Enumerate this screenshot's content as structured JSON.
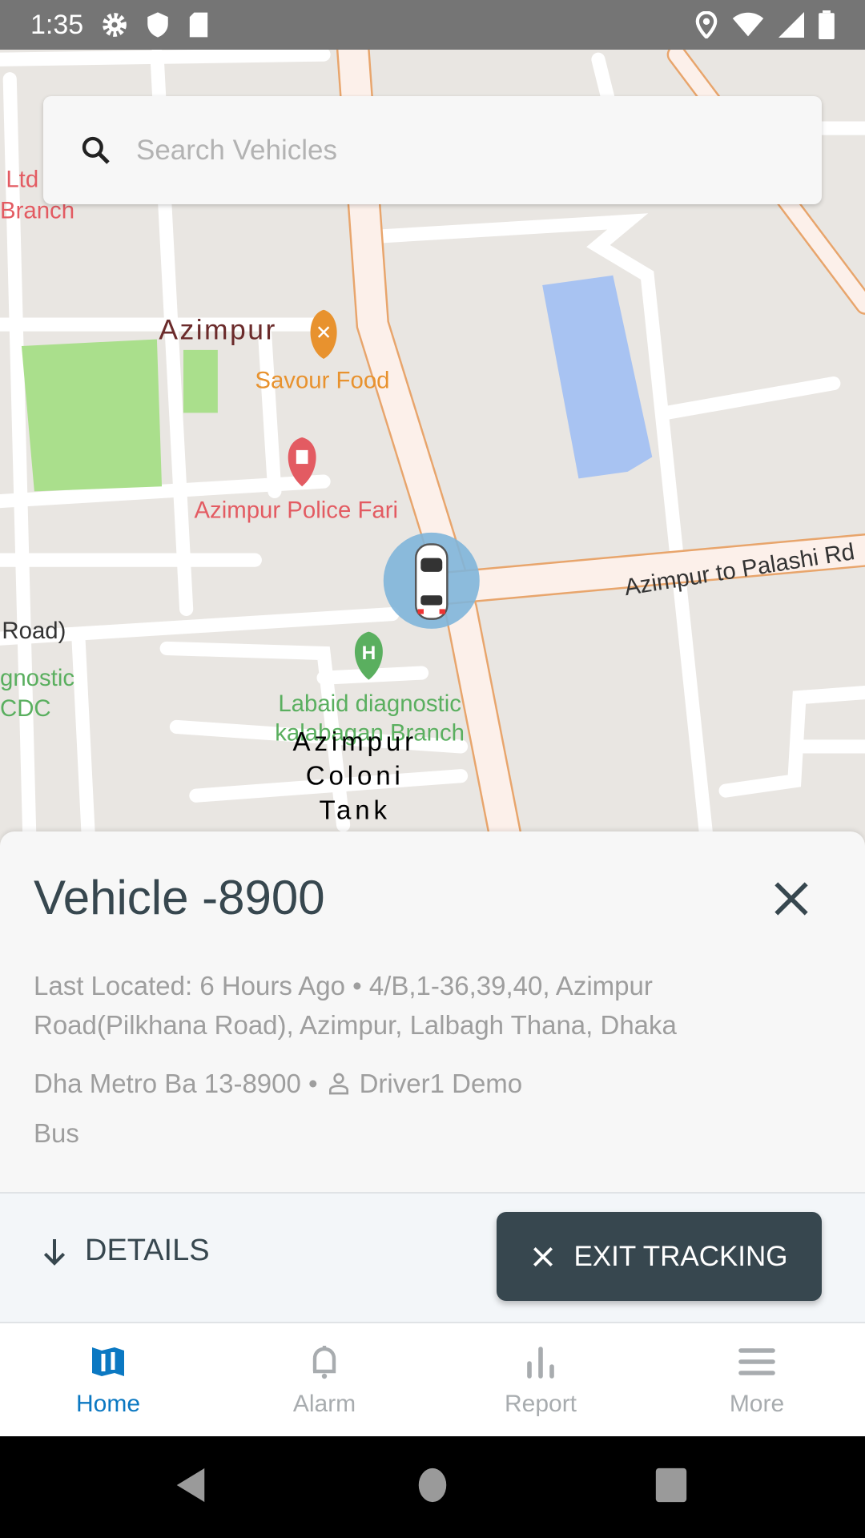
{
  "status_bar": {
    "time": "1:35",
    "icons": [
      "gear-icon",
      "shield-icon",
      "sd-card-icon",
      "location-icon",
      "wifi-icon",
      "signal-icon",
      "battery-icon"
    ]
  },
  "search": {
    "placeholder": "Search Vehicles",
    "value": ""
  },
  "map": {
    "labels": {
      "ltd": "Ltd",
      "branch": "Branch",
      "azimpur": "Azimpur",
      "savour": "Savour Food",
      "police": "Azimpur Police Fari",
      "palashi": "Azimpur to Palashi Rd",
      "road": "Road)",
      "gnostic": "gnostic",
      "cdc": "CDC",
      "labaid1": "Labaid diagnostic",
      "labaid2": "kalabagan Branch",
      "colony1": "Azimpur",
      "colony2": "Coloni",
      "colony3": "Tank"
    },
    "colors": {
      "land": "#e9e6e2",
      "road": "#ffffff",
      "main_road": "#fcf0ea",
      "main_road_edge": "#e8a56c",
      "park": "#aadf8c",
      "water": "#a8c3f2",
      "restaurant": "#e8922e",
      "police": "#e35b62",
      "hospital": "#5aaf5f"
    }
  },
  "vehicle": {
    "title": "Vehicle -8900",
    "last_located": "Last Located: 6 Hours Ago • 4/B,1-36,39,40, Azimpur Road(Pilkhana Road), Azimpur, Lalbagh Thana, Dhaka",
    "plate": "Dha Metro Ba 13-8900 •",
    "driver": "Driver1 Demo",
    "type": "Bus"
  },
  "actions": {
    "details": "DETAILS",
    "exit": "EXIT TRACKING"
  },
  "nav": {
    "items": [
      {
        "label": "Home",
        "icon": "map-icon",
        "active": true
      },
      {
        "label": "Alarm",
        "icon": "bell-icon"
      },
      {
        "label": "Report",
        "icon": "bar-chart-icon"
      },
      {
        "label": "More",
        "icon": "menu-icon"
      }
    ]
  },
  "colors": {
    "accent": "#0b78c2",
    "dark": "#37474f",
    "status_bar": "#757575"
  }
}
